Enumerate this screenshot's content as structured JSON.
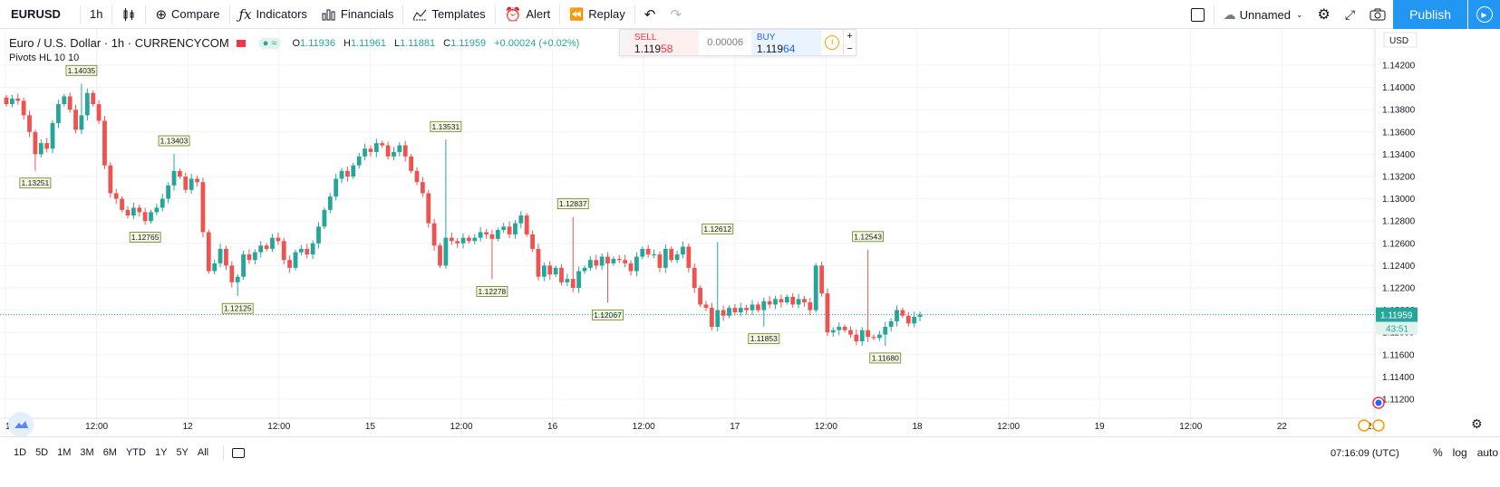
{
  "toolbar": {
    "symbol": "EURUSD",
    "interval": "1h",
    "compare_label": "Compare",
    "indicators_label": "Indicators",
    "financials_label": "Financials",
    "templates_label": "Templates",
    "alert_label": "Alert",
    "replay_label": "Replay",
    "layout_name": "Unnamed",
    "publish_label": "Publish"
  },
  "legend": {
    "title": "Euro / U.S. Dollar · 1h · CURRENCYCOM",
    "eye_glyph": "≈",
    "o_label": "O",
    "o_value": "1.11936",
    "h_label": "H",
    "h_value": "1.11961",
    "l_label": "L",
    "l_value": "1.11881",
    "c_label": "C",
    "c_value": "1.11959",
    "change": "+0.00024 (+0.02%)",
    "indicator": "Pivots HL 10 10"
  },
  "trade": {
    "sell_label": "SELL",
    "sell_price_main": "1.119",
    "sell_price_big": "58",
    "spread": "0.00006",
    "buy_label": "BUY",
    "buy_price_main": "1.119",
    "buy_price_big": "64",
    "plus": "+",
    "minus": "−"
  },
  "chart_data": {
    "type": "candlestick",
    "currency_label": "USD",
    "last_price": "1.11959",
    "countdown": "43:51",
    "ylim": [
      1.11,
      1.144
    ],
    "y_ticks": [
      "1.14200",
      "1.14000",
      "1.13800",
      "1.13600",
      "1.13400",
      "1.13200",
      "1.13000",
      "1.12800",
      "1.12600",
      "1.12400",
      "1.12200",
      "1.12000",
      "1.11800",
      "1.11600",
      "1.11400",
      "1.11200"
    ],
    "x_ticks": [
      "11",
      "12:00",
      "12",
      "12:00",
      "15",
      "12:00",
      "16",
      "12:00",
      "17",
      "12:00",
      "18",
      "12:00",
      "19",
      "12:00",
      "22",
      "12:00"
    ],
    "pivot_labels": [
      {
        "label": "1.14035",
        "type": "high",
        "bar": 13
      },
      {
        "label": "1.13251",
        "type": "low",
        "bar": 5
      },
      {
        "label": "1.13403",
        "type": "high",
        "bar": 29
      },
      {
        "label": "1.12765",
        "type": "low",
        "bar": 24
      },
      {
        "label": "1.12125",
        "type": "low",
        "bar": 40
      },
      {
        "label": "1.13531",
        "type": "high",
        "bar": 76
      },
      {
        "label": "1.12278",
        "type": "low",
        "bar": 84
      },
      {
        "label": "1.12837",
        "type": "high",
        "bar": 98
      },
      {
        "label": "1.12067",
        "type": "low",
        "bar": 104
      },
      {
        "label": "1.12612",
        "type": "high",
        "bar": 123
      },
      {
        "label": "1.11853",
        "type": "low",
        "bar": 131
      },
      {
        "label": "1.12543",
        "type": "high",
        "bar": 149
      },
      {
        "label": "1.11680",
        "type": "low",
        "bar": 152
      }
    ],
    "closes": [
      1.1385,
      1.139,
      1.1388,
      1.1375,
      1.136,
      1.134,
      1.135,
      1.1345,
      1.1368,
      1.1385,
      1.1392,
      1.138,
      1.1362,
      1.1375,
      1.1395,
      1.1385,
      1.137,
      1.133,
      1.1305,
      1.13,
      1.129,
      1.1285,
      1.1292,
      1.1288,
      1.128,
      1.1288,
      1.1292,
      1.13,
      1.1312,
      1.1325,
      1.132,
      1.1308,
      1.1318,
      1.1315,
      1.127,
      1.1235,
      1.1242,
      1.1255,
      1.124,
      1.1225,
      1.123,
      1.125,
      1.1245,
      1.1252,
      1.1258,
      1.1255,
      1.1265,
      1.1262,
      1.1245,
      1.1238,
      1.1252,
      1.1255,
      1.125,
      1.126,
      1.1275,
      1.129,
      1.1302,
      1.1318,
      1.1325,
      1.132,
      1.133,
      1.1338,
      1.1345,
      1.1342,
      1.135,
      1.1348,
      1.1338,
      1.1342,
      1.1348,
      1.1338,
      1.1325,
      1.1315,
      1.1305,
      1.1278,
      1.1258,
      1.124,
      1.1265,
      1.1262,
      1.126,
      1.1265,
      1.1262,
      1.1265,
      1.127,
      1.1268,
      1.1264,
      1.1272,
      1.1275,
      1.1268,
      1.1278,
      1.1285,
      1.1268,
      1.1255,
      1.123,
      1.124,
      1.1232,
      1.1238,
      1.1225,
      1.1228,
      1.122,
      1.1235,
      1.1238,
      1.1245,
      1.124,
      1.1248,
      1.1242,
      1.1246,
      1.1245,
      1.1242,
      1.1235,
      1.1248,
      1.1255,
      1.125,
      1.125,
      1.1238,
      1.1255,
      1.1245,
      1.125,
      1.1257,
      1.1238,
      1.122,
      1.1205,
      1.1202,
      1.1185,
      1.12,
      1.1195,
      1.1202,
      1.1198,
      1.1202,
      1.12,
      1.1205,
      1.12,
      1.1208,
      1.1205,
      1.121,
      1.1207,
      1.1212,
      1.1205,
      1.121,
      1.1207,
      1.12,
      1.124,
      1.1215,
      1.118,
      1.1182,
      1.1185,
      1.1182,
      1.1178,
      1.1172,
      1.1182,
      1.1176,
      1.1175,
      1.1178,
      1.1185,
      1.119,
      1.12,
      1.1195,
      1.1188,
      1.1194,
      1.1196
    ]
  }
}
